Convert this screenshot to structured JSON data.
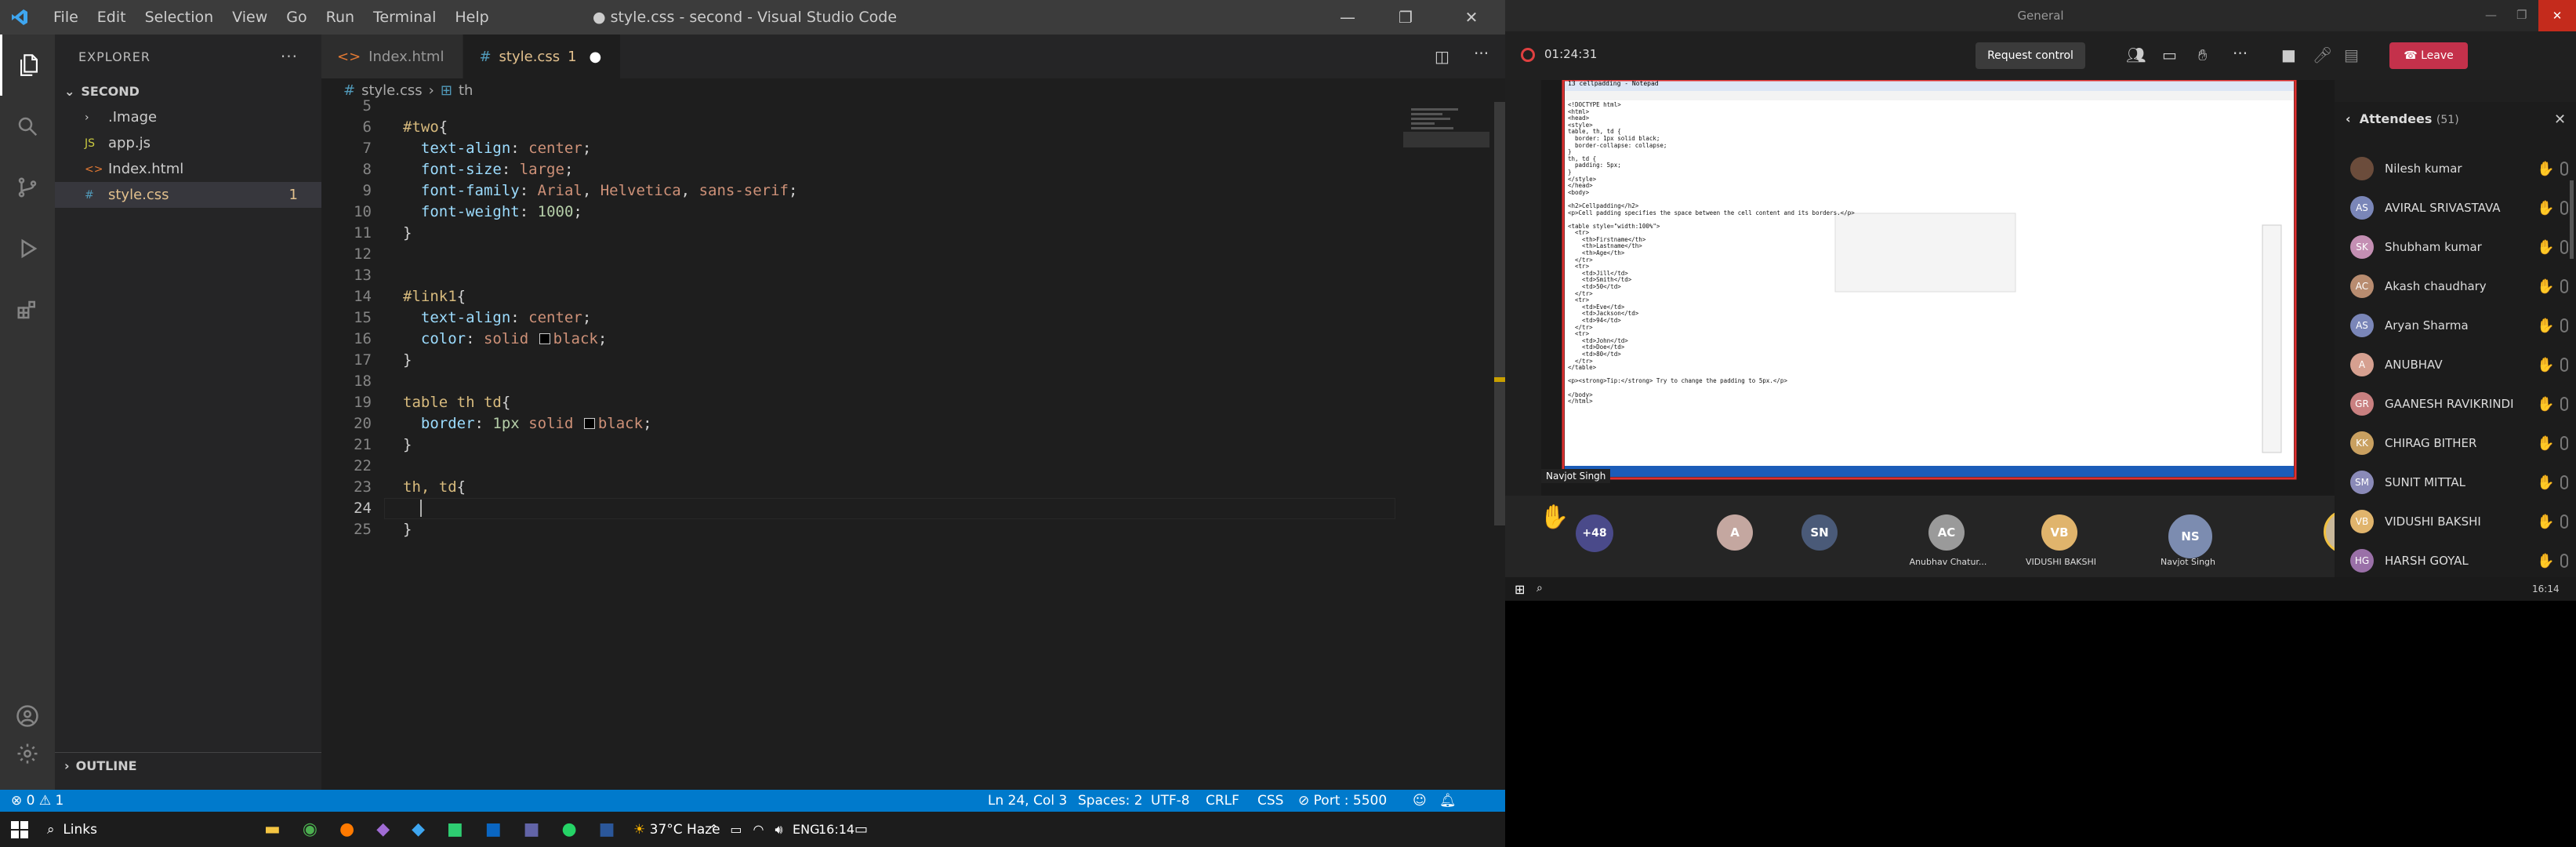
{
  "vscode": {
    "menu": [
      "File",
      "Edit",
      "Selection",
      "View",
      "Go",
      "Run",
      "Terminal",
      "Help"
    ],
    "window_title": "● style.css - second - Visual Studio Code",
    "explorer_label": "EXPLORER",
    "folder": "SECOND",
    "files": [
      {
        "name": ".Image",
        "type": "folder"
      },
      {
        "name": "app.js",
        "type": "js",
        "badge": "JS"
      },
      {
        "name": "Index.html",
        "type": "html",
        "badge": "<>"
      },
      {
        "name": "style.css",
        "type": "css",
        "badge": "#",
        "count": "1"
      }
    ],
    "outline_label": "OUTLINE",
    "tabs": [
      {
        "label": "Index.html",
        "icon": "<>"
      },
      {
        "label": "style.css",
        "count": "1",
        "dirty": "●",
        "icon": "#"
      }
    ],
    "breadcrumb": [
      "style.css",
      "th"
    ],
    "code_lines": [
      {
        "n": "5",
        "t": ""
      },
      {
        "n": "6",
        "t": "#two{"
      },
      {
        "n": "7",
        "t": "  text-align: center;"
      },
      {
        "n": "8",
        "t": "  font-size: large;"
      },
      {
        "n": "9",
        "t": "  font-family: Arial, Helvetica, sans-serif;"
      },
      {
        "n": "10",
        "t": "  font-weight: 1000;"
      },
      {
        "n": "11",
        "t": "}"
      },
      {
        "n": "12",
        "t": ""
      },
      {
        "n": "13",
        "t": ""
      },
      {
        "n": "14",
        "t": "#link1{"
      },
      {
        "n": "15",
        "t": "  text-align: center;"
      },
      {
        "n": "16",
        "t": "  color: solid black;"
      },
      {
        "n": "17",
        "t": "}"
      },
      {
        "n": "18",
        "t": ""
      },
      {
        "n": "19",
        "t": "table th td{"
      },
      {
        "n": "20",
        "t": "  border: 1px solid black;"
      },
      {
        "n": "21",
        "t": "}"
      },
      {
        "n": "22",
        "t": ""
      },
      {
        "n": "23",
        "t": "th, td{"
      },
      {
        "n": "24",
        "t": ""
      },
      {
        "n": "25",
        "t": "}"
      }
    ],
    "status": {
      "errors": "0",
      "warnings": "1",
      "position": "Ln 24, Col 3",
      "spaces": "Spaces: 2",
      "encoding": "UTF-8",
      "eol": "CRLF",
      "language": "CSS",
      "port": "Port : 5500"
    }
  },
  "teams": {
    "title": "General",
    "timer": "01:24:31",
    "request_control": "Request control",
    "leave": "Leave",
    "presenter": "Navjot Singh",
    "overflow_count": "+48",
    "tiles": [
      {
        "initials": "A",
        "color": "#c4a7a0"
      },
      {
        "initials": "SN",
        "color": "#4a5a78"
      },
      {
        "initials": "AC",
        "color": "#9a9a9a",
        "name": "Anubhav Chatur..."
      },
      {
        "initials": "VB",
        "color": "#e0b46c",
        "name": "VIDUSHI BAKSHI"
      },
      {
        "initials": "NS",
        "color": "#7c8cb0",
        "name": "Navjot Singh"
      },
      {
        "initials": "A",
        "color": "#c9b89a"
      }
    ],
    "attendees_label": "Attendees",
    "attendees_count": "(51)",
    "attendees": [
      {
        "name": "Nilesh kumar",
        "initials": "",
        "color": "#6b4c3b"
      },
      {
        "name": "AVIRAL SRIVASTAVA",
        "initials": "AS",
        "color": "#7a86b8"
      },
      {
        "name": "Shubham kumar",
        "initials": "SK",
        "color": "#c48fb3"
      },
      {
        "name": "Akash chaudhary",
        "initials": "AC",
        "color": "#b88c70"
      },
      {
        "name": "Aryan Sharma",
        "initials": "AS",
        "color": "#7a86b8"
      },
      {
        "name": "ANUBHAV",
        "initials": "A",
        "color": "#d6a090"
      },
      {
        "name": "GAANESH RAVIKRINDI",
        "initials": "GR",
        "color": "#c98080"
      },
      {
        "name": "CHIRAG BITHER",
        "initials": "KK",
        "color": "#c9a060"
      },
      {
        "name": "SUNIT MITTAL",
        "initials": "SM",
        "color": "#8a8ab8"
      },
      {
        "name": "VIDUSHI BAKSHI",
        "initials": "VB",
        "color": "#e0b46c"
      },
      {
        "name": "HARSH GOYAL",
        "initials": "HG",
        "color": "#9a70a8"
      }
    ],
    "notepad_title": "13 cellpadding - Notepad",
    "notepad_lines": [
      "<!DOCTYPE html>",
      "<html>",
      "<head>",
      "<style>",
      "table, th, td {",
      "  border: 1px solid black;",
      "  border-collapse: collapse;",
      "}",
      "th, td {",
      "  padding: 5px;",
      "}",
      "</style>",
      "</head>",
      "<body>",
      "",
      "<h2>Cellpadding</h2>",
      "<p>Cell padding specifies the space between the cell content and its borders.</p>",
      "",
      "<table style=\"width:100%\">",
      "  <tr>",
      "    <th>Firstname</th>",
      "    <th>Lastname</th>",
      "    <th>Age</th>",
      "  </tr>",
      "  <tr>",
      "    <td>Jill</td>",
      "    <td>Smith</td>",
      "    <td>50</td>",
      "  </tr>",
      "  <tr>",
      "    <td>Eve</td>",
      "    <td>Jackson</td>",
      "    <td>94</td>",
      "  </tr>",
      "  <tr>",
      "    <td>John</td>",
      "    <td>Doe</td>",
      "    <td>80</td>",
      "  </tr>",
      "</table>",
      "",
      "<p><strong>Tip:</strong> Try to change the padding to 5px.</p>",
      "",
      "</body>",
      "</html>"
    ],
    "clock": "16:14"
  },
  "taskbar": {
    "search": "Links",
    "weather": "37°C Haze",
    "lang": "ENG",
    "time": "16:14"
  }
}
